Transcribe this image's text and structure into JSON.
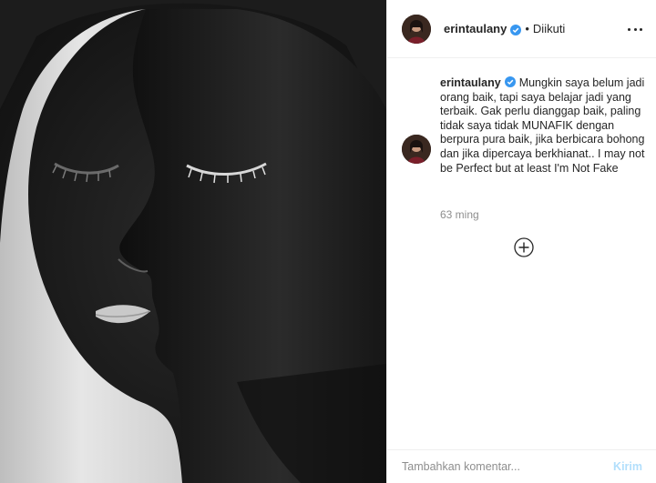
{
  "post": {
    "image_alt": "Black and white portrait of a face painted half white and half black",
    "account": {
      "username": "erintaulany",
      "verified": true,
      "follow_state": "Diikuti"
    },
    "caption": {
      "username": "erintaulany",
      "text": "Mungkin saya belum jadi orang baik, tapi saya belajar jadi yang terbaik. Gak perlu dianggap baik, paling tidak saya tidak MUNAFIK dengan berpura pura baik, jika berbicara bohong dan jika dipercaya berkhianat.. I may not be Perfect but at least I'm Not Fake"
    },
    "timestamp": "63 ming",
    "comment": {
      "placeholder": "Tambahkan komentar...",
      "value": "",
      "post_label": "Kirim"
    }
  },
  "icons": {
    "verified": "verified-badge-icon",
    "more": "more-options-icon",
    "load_more": "load-more-comments-icon"
  },
  "colors": {
    "verified_badge": "#3897f0",
    "post_button_disabled": "#b2dffc",
    "timestamp": "#8e8e8e",
    "divider": "#efefef"
  }
}
